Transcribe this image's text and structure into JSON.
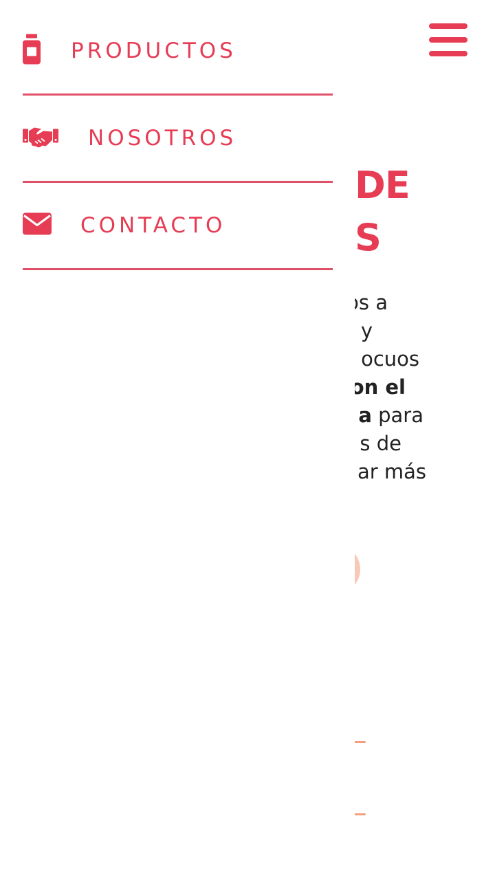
{
  "colors": {
    "accent": "#e63c54",
    "divider": "#e05068",
    "peach": "#f8c9b6"
  },
  "header": {
    "menu_icon": "hamburger-menu-icon"
  },
  "drawer": {
    "items": [
      {
        "label": "PRODUCTOS",
        "icon": "jar-icon"
      },
      {
        "label": "NOSOTROS",
        "icon": "handshake-icon"
      },
      {
        "label": "CONTACTO",
        "icon": "envelope-icon"
      }
    ]
  },
  "background": {
    "title_line1": "DE",
    "title_line2": "S",
    "text_lines": [
      "os a",
      "y",
      "ocuos",
      "on el",
      "a",
      " para",
      "s de",
      "ar más"
    ]
  }
}
